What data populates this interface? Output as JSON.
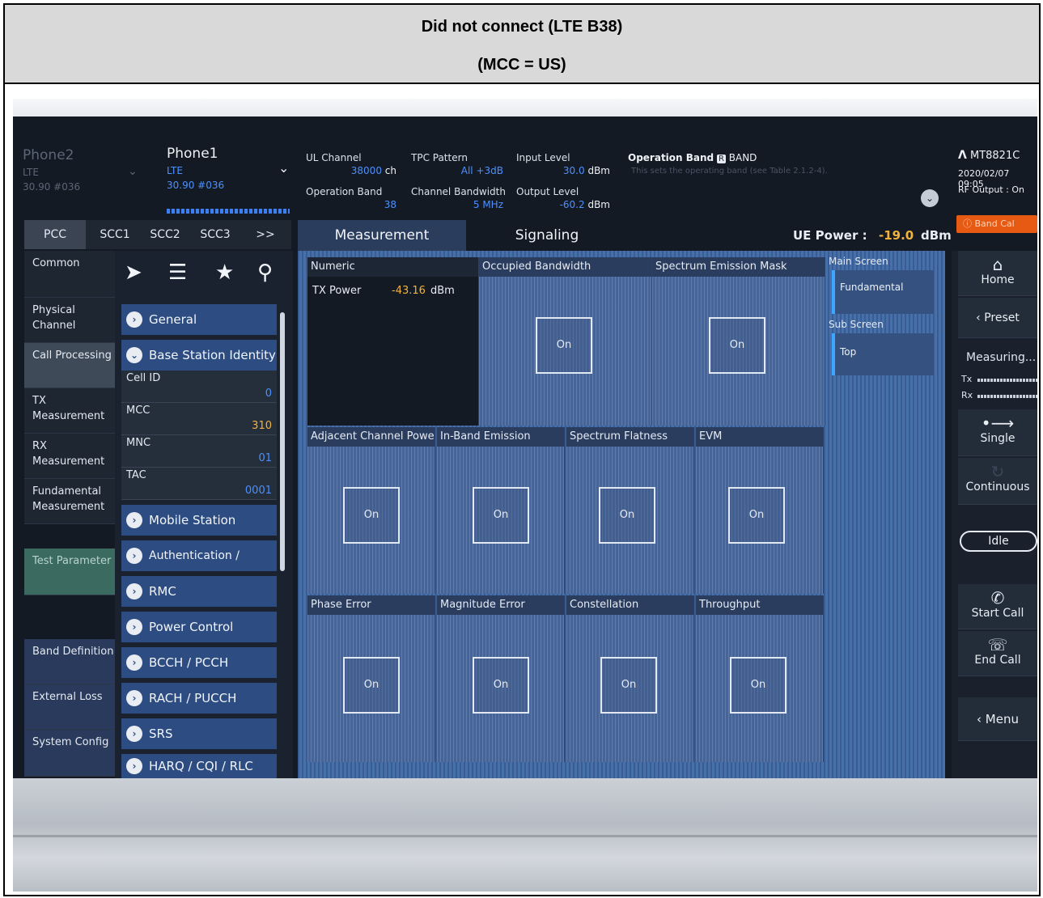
{
  "document": {
    "title": "Did not connect (LTE B38)",
    "subtitle": "(MCC = US)"
  },
  "header": {
    "phone2": {
      "name": "Phone2",
      "tech": "LTE",
      "info": "30.90 #036"
    },
    "phone1": {
      "name": "Phone1",
      "tech": "LTE",
      "info": "30.90 #036"
    },
    "params": {
      "ul_channel": {
        "label": "UL Channel",
        "value": "38000",
        "unit": "ch"
      },
      "operation_band": {
        "label": "Operation Band",
        "value": "38"
      },
      "tpc_pattern": {
        "label": "TPC Pattern",
        "value": "All +3dB"
      },
      "channel_bandwidth": {
        "label": "Channel Bandwidth",
        "value": "5",
        "unit": "MHz"
      },
      "input_level": {
        "label": "Input Level",
        "value": "30.0",
        "unit": "dBm"
      },
      "output_level": {
        "label": "Output Level",
        "value": "-60.2",
        "unit": "dBm"
      }
    },
    "op_band_help": {
      "title": "Operation Band",
      "badge": "R",
      "keyword": "BAND",
      "desc": "This sets the operating band (see Table 2.1.2-4)."
    },
    "brand": "MT8821C",
    "datetime": "2020/02/07 09:05",
    "rf_output": "RF Output : On"
  },
  "cc_tabs": [
    "PCC",
    "SCC1",
    "SCC2",
    "SCC3",
    ">>"
  ],
  "main_tabs": [
    "Measurement",
    "Signaling"
  ],
  "ue_power": {
    "label": "UE Power :",
    "value": "-19.0",
    "unit": "dBm"
  },
  "band_cal": "Band Cal",
  "categories": [
    "Common",
    "Physical Channel",
    "Call Processing",
    "TX Measurement",
    "RX Measurement",
    "Fundamental Measurement",
    "Test Parameter",
    "Band Definition",
    "External Loss",
    "System Config"
  ],
  "tree": {
    "sections": [
      "General",
      "Base Station Identity",
      "Mobile Station Identity",
      "Authentication / Integrity",
      "RMC",
      "Power Control",
      "BCCH / PCCH",
      "RACH / PUCCH",
      "SRS",
      "HARQ / CQI / RLC"
    ],
    "fields": [
      {
        "name": "Cell ID",
        "value": "0"
      },
      {
        "name": "MCC",
        "value": "310"
      },
      {
        "name": "MNC",
        "value": "01"
      },
      {
        "name": "TAC",
        "value": "0001"
      }
    ]
  },
  "measurements": {
    "numeric": {
      "title": "Numeric",
      "tx_label": "TX Power",
      "tx_value": "-43.16",
      "tx_unit": "dBm"
    },
    "tiles": [
      "Occupied Bandwidth",
      "Spectrum Emission Mask",
      "Adjacent Channel Power",
      "In-Band Emission",
      "Spectrum Flatness",
      "EVM",
      "Phase Error",
      "Magnitude Error",
      "Constellation",
      "Throughput"
    ],
    "on_label": "On",
    "side": {
      "main_screen": "Main Screen",
      "fundamental": "Fundamental",
      "sub_screen": "Sub Screen",
      "top": "Top"
    }
  },
  "controls": {
    "home": "Home",
    "preset": "Preset",
    "measuring": "Measuring...",
    "tx": "Tx",
    "rx": "Rx",
    "single": "Single",
    "continuous": "Continuous",
    "idle": "Idle",
    "start_call": "Start Call",
    "end_call": "End Call",
    "menu": "Menu"
  }
}
